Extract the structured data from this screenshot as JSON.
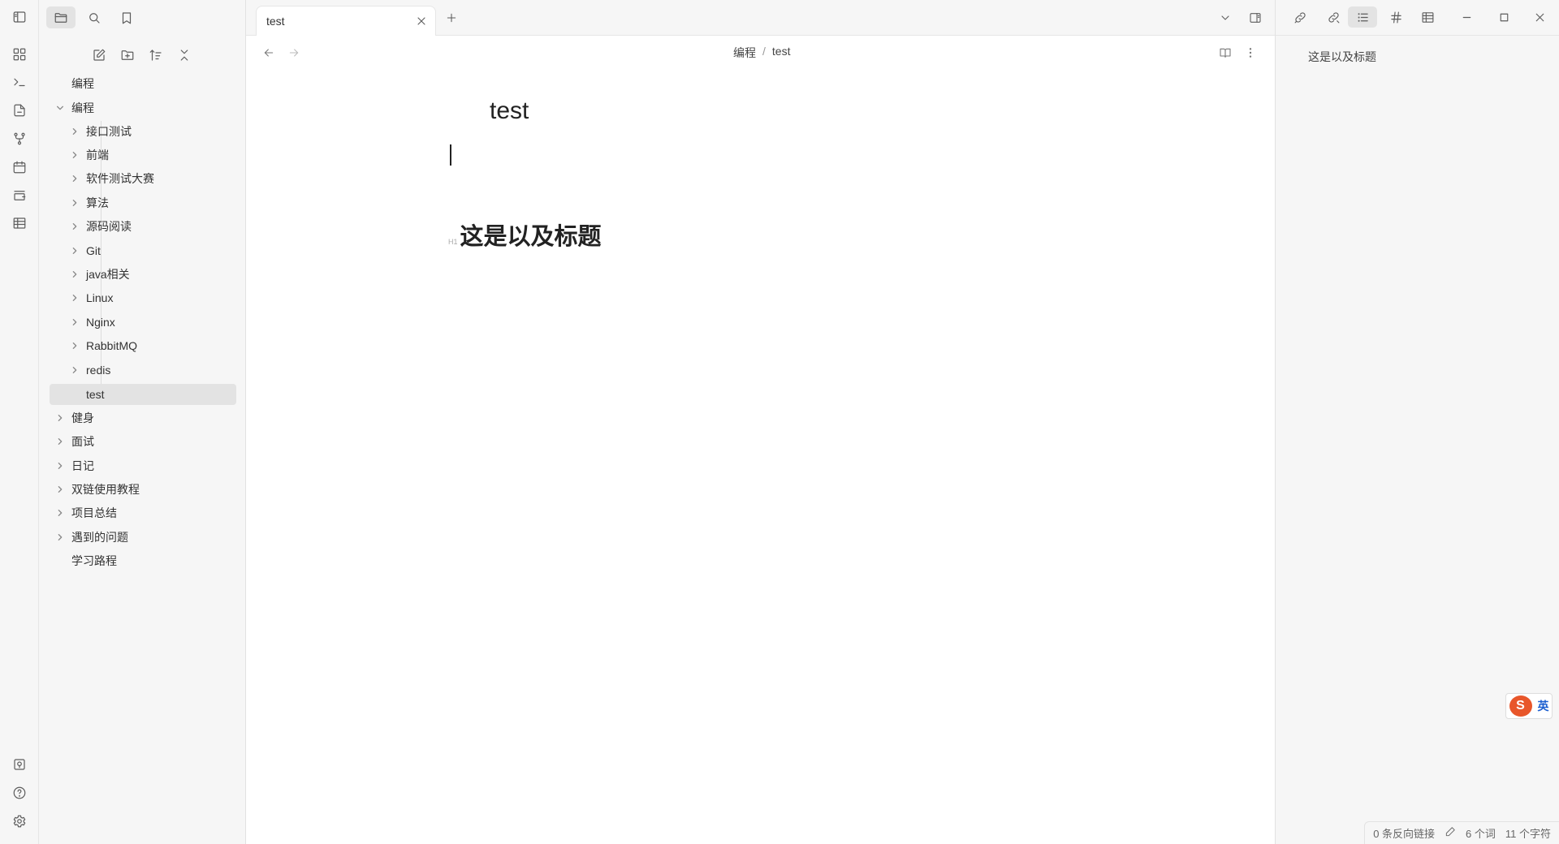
{
  "tab": {
    "title": "test"
  },
  "breadcrumb": {
    "parent": "编程",
    "separator": "/",
    "current": "test"
  },
  "note": {
    "title": "test",
    "heading_marker": "H1",
    "heading_text": "这是以及标题"
  },
  "tree": {
    "top_item": "编程",
    "folder_open": "编程",
    "children": [
      "接口测试",
      "前端",
      "软件测试大赛",
      "算法",
      "源码阅读",
      "Git",
      "java相关",
      "Linux",
      "Nginx",
      "RabbitMQ",
      "redis"
    ],
    "active_file": "test",
    "root_folders": [
      "健身",
      "面试",
      "日记",
      "双链使用教程",
      "项目总结",
      "遇到的问题"
    ],
    "root_file": "学习路程"
  },
  "outline": {
    "items": [
      "这是以及标题"
    ]
  },
  "status": {
    "backlinks": "0 条反向链接",
    "words": "6 个词",
    "chars": "11 个字符"
  },
  "ime": {
    "logo": "S",
    "lang": "英"
  },
  "icons": {
    "ribbon_top": [
      "sidebar-toggle-icon"
    ],
    "ribbon": [
      "graph-view-icon",
      "terminal-icon",
      "file-import-icon",
      "git-icon",
      "calendar-icon",
      "kanban-icon",
      "table-icon"
    ],
    "ribbon_bottom": [
      "vault-icon",
      "help-icon",
      "settings-icon"
    ]
  },
  "colors": {
    "active_bg": "#e3e3e3",
    "panel_bg": "#f6f6f6",
    "ime_logo": "#e8562a"
  }
}
